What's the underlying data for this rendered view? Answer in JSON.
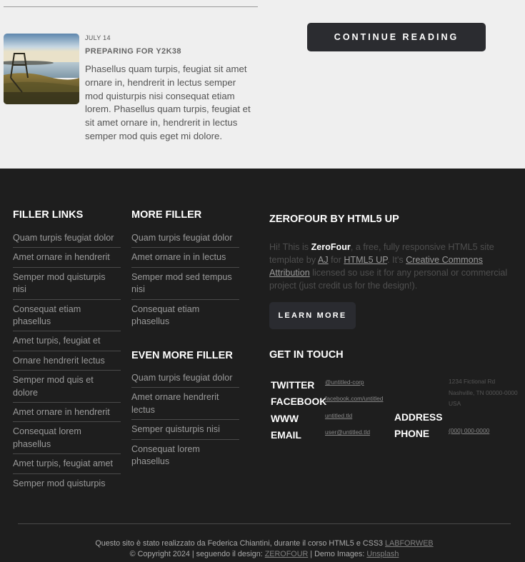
{
  "post": {
    "image": "lake-landscape-photo",
    "date": "JULY 14",
    "title": "PREPARING FOR Y2K38",
    "body": "Phasellus quam turpis, feugiat sit amet ornare in, hendrerit in lectus semper mod quisturpis nisi consequat etiam lorem. Phasellus quam turpis, feugiat et sit amet ornare in, hendrerit in lectus semper mod quis eget mi dolore."
  },
  "continue_label": "CONTINUE READING",
  "filler_links": {
    "heading": "FILLER LINKS",
    "items": [
      "Quam turpis feugiat dolor",
      "Amet ornare in hendrerit",
      "Semper mod quisturpis nisi",
      "Consequat etiam phasellus",
      "Amet turpis, feugiat et",
      "Ornare hendrerit lectus",
      "Semper mod quis et dolore",
      "Amet ornare in hendrerit",
      "Consequat lorem phasellus",
      "Amet turpis, feugiat amet",
      "Semper mod quisturpis"
    ]
  },
  "more_filler": {
    "heading": "MORE FILLER",
    "items": [
      "Quam turpis feugiat dolor",
      "Amet ornare in in lectus",
      "Semper mod sed tempus nisi",
      "Consequat etiam phasellus"
    ]
  },
  "even_more_filler": {
    "heading": "EVEN MORE FILLER",
    "items": [
      "Quam turpis feugiat dolor",
      "Amet ornare hendrerit lectus",
      "Semper quisturpis nisi",
      "Consequat lorem phasellus"
    ]
  },
  "about": {
    "heading": "ZEROFOUR BY HTML5 UP",
    "t1": "Hi! This is ",
    "brand": "ZeroFour",
    "t2": ", a free, fully responsive HTML5 site template by ",
    "author": "AJ",
    "t3": " for ",
    "site": "HTML5 UP",
    "t4": ". It's ",
    "license": "Creative Commons Attribution",
    "t5": " licensed so use it for any personal or commercial project (just credit us for the design!).",
    "button": "LEARN MORE"
  },
  "contact": {
    "heading": "GET IN TOUCH",
    "twitter_label": "TWITTER",
    "twitter": "@untitled-corp",
    "facebook_label": "FACEBOOK",
    "facebook": "facebook.com/untitled",
    "www_label": "WWW",
    "www": "untitled.tld",
    "email_label": "EMAIL",
    "email": "user@untitled.tld",
    "address_label": "ADDRESS",
    "address_line1": "1234 Fictional Rd",
    "address_line2": "Nashville, TN 00000-0000",
    "address_line3": "USA",
    "phone_label": "PHONE",
    "phone": "(000) 000-0000"
  },
  "credits": {
    "line1": "Questo sito è stato realizzato da Federica Chiantini, durante il corso HTML5 e CSS3 ",
    "labforweb": "LABFORWEB",
    "line2a": "© Copyright 2024 | seguendo il design: ",
    "zerofour": "ZEROFOUR",
    "line2b": " | Demo Images: ",
    "unsplash": "Unsplash"
  }
}
